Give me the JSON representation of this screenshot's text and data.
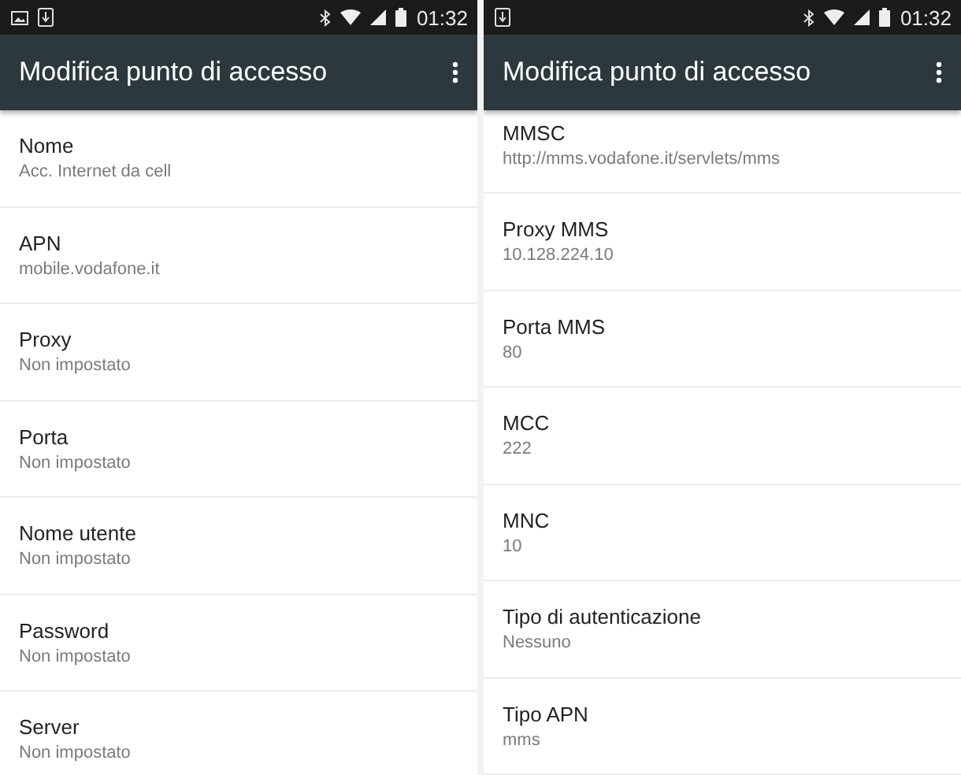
{
  "screens": [
    {
      "status_bar": {
        "notifications": [
          {
            "kind": "image"
          },
          {
            "kind": "download"
          }
        ],
        "time": "01:32"
      },
      "toolbar": {
        "title": "Modifica punto di accesso"
      },
      "scrolled": false,
      "settings": [
        {
          "label": "Nome",
          "value": "Acc. Internet da cell"
        },
        {
          "label": "APN",
          "value": "mobile.vodafone.it"
        },
        {
          "label": "Proxy",
          "value": "Non impostato"
        },
        {
          "label": "Porta",
          "value": "Non impostato"
        },
        {
          "label": "Nome utente",
          "value": "Non impostato"
        },
        {
          "label": "Password",
          "value": "Non impostato"
        },
        {
          "label": "Server",
          "value": "Non impostato"
        }
      ]
    },
    {
      "status_bar": {
        "notifications": [
          {
            "kind": "download"
          }
        ],
        "time": "01:32"
      },
      "toolbar": {
        "title": "Modifica punto di accesso"
      },
      "scrolled": true,
      "settings": [
        {
          "label": "MMSC",
          "value": "http://mms.vodafone.it/servlets/mms"
        },
        {
          "label": "Proxy MMS",
          "value": "10.128.224.10"
        },
        {
          "label": "Porta MMS",
          "value": "80"
        },
        {
          "label": "MCC",
          "value": "222"
        },
        {
          "label": "MNC",
          "value": "10"
        },
        {
          "label": "Tipo di autenticazione",
          "value": "Nessuno"
        },
        {
          "label": "Tipo APN",
          "value": "mms"
        }
      ]
    }
  ]
}
